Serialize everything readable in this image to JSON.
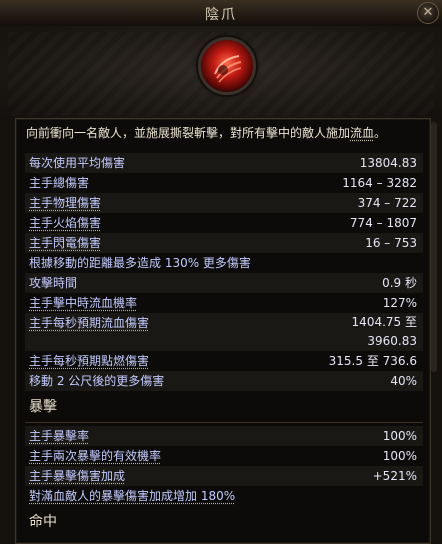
{
  "window": {
    "title": "陰爪",
    "close_label": "✕"
  },
  "skill": {
    "icon": "claw-skill-icon"
  },
  "description": {
    "before": "向前衝向一名敵人，並施展撕裂斬擊，對所有擊中的敵人施加",
    "keyword": "流血",
    "after": "。"
  },
  "stats": [
    {
      "label": "每次使用平均傷害",
      "value": "13804.83"
    },
    {
      "label": "主手總傷害",
      "value": "1164 – 3282"
    },
    {
      "label": "主手物理傷害",
      "value": "374 – 722"
    },
    {
      "label": "主手火焰傷害",
      "value": "774 – 1807"
    },
    {
      "label": "主手閃電傷害",
      "value": "16 – 753"
    },
    {
      "label": "根據移動的距離最多造成 130% 更多傷害",
      "value": ""
    },
    {
      "label": "攻擊時間",
      "value": "0.9 秒"
    },
    {
      "label": "主手擊中時流血機率",
      "value": "127%"
    },
    {
      "label": "主手每秒預期流血傷害",
      "value": "1404.75 至",
      "value2": "3960.83"
    },
    {
      "label": "主手每秒預期點燃傷害",
      "value": "315.5 至 736.6"
    },
    {
      "label": "移動 2 公尺後的更多傷害",
      "value": "40%"
    }
  ],
  "crit_section": {
    "title": "暴擊",
    "rows": [
      {
        "label": "主手暴擊率",
        "value": "100%"
      },
      {
        "label": "主手兩次暴擊的有效機率",
        "value": "100%"
      },
      {
        "label": "主手暴擊傷害加成",
        "value": "+521%"
      },
      {
        "label": "對滿血敵人的暴擊傷害加成增加 180%",
        "value": ""
      }
    ]
  },
  "hit_section": {
    "title": "命中"
  }
}
